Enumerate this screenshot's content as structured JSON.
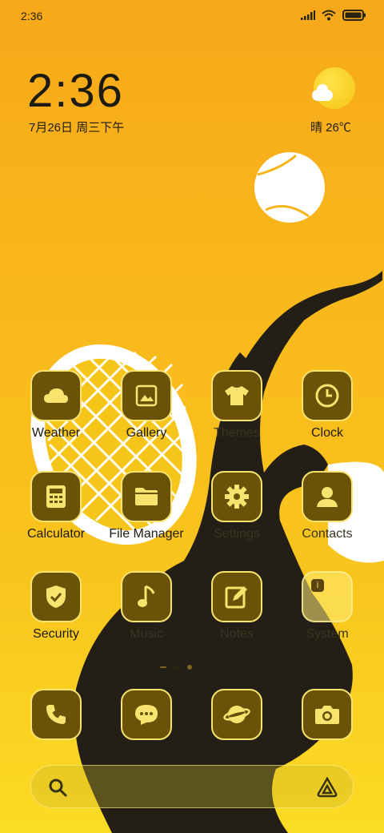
{
  "status_bar": {
    "time": "2:36",
    "signal_icon": "signal-icon",
    "wifi_icon": "wifi-icon",
    "battery_icon": "battery-icon"
  },
  "clock_widget": {
    "time": "2:36",
    "date": "7月26日 周三下午"
  },
  "weather_widget": {
    "condition_icon": "sun-cloud-icon",
    "text": "晴 26℃"
  },
  "apps": [
    {
      "label": "Weather",
      "icon": "weather-icon"
    },
    {
      "label": "Gallery",
      "icon": "gallery-icon"
    },
    {
      "label": "Themes",
      "icon": "themes-icon"
    },
    {
      "label": "Clock",
      "icon": "clock-icon"
    },
    {
      "label": "Calculator",
      "icon": "calculator-icon"
    },
    {
      "label": "File Manager",
      "icon": "folder-icon"
    },
    {
      "label": "Settings",
      "icon": "gear-icon"
    },
    {
      "label": "Contacts",
      "icon": "contacts-icon"
    },
    {
      "label": "Security",
      "icon": "shield-icon"
    },
    {
      "label": "Music",
      "icon": "music-icon"
    },
    {
      "label": "Notes",
      "icon": "notes-icon"
    },
    {
      "label": "System",
      "icon": "folder-system-icon"
    }
  ],
  "page_indicator": {
    "pages": 3,
    "active": 2
  },
  "dock": [
    {
      "icon": "phone-icon"
    },
    {
      "icon": "messages-icon"
    },
    {
      "icon": "browser-icon"
    },
    {
      "icon": "camera-icon"
    }
  ],
  "search_bar": {
    "left_icon": "search-icon",
    "right_icon": "assistant-icon"
  },
  "colors": {
    "tile": "#6a5208",
    "tile_border": "#f7e36e",
    "background_top": "#f6a81a",
    "background_bottom": "#fadc25"
  }
}
